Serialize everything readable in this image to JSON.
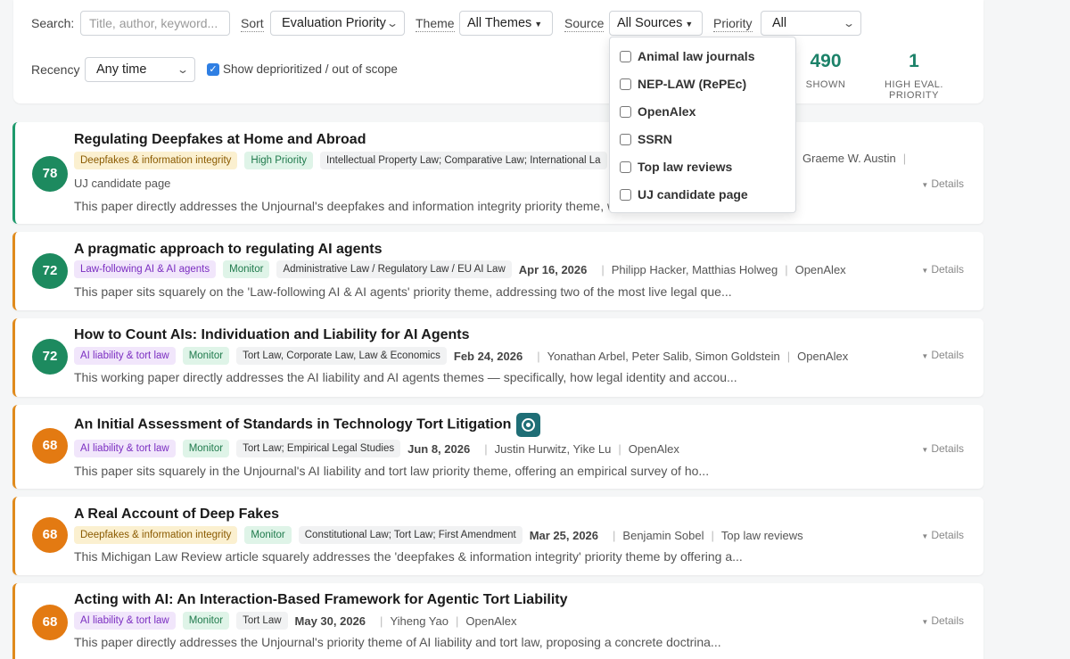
{
  "filters": {
    "search_label": "Search:",
    "search_placeholder": "Title, author, keyword...",
    "sort_label": "Sort",
    "sort_value": "Evaluation Priority",
    "theme_label": "Theme",
    "theme_value": "All Themes",
    "source_label": "Source",
    "source_value": "All Sources",
    "priority_label": "Priority",
    "priority_value": "All",
    "recency_label": "Recency",
    "recency_value": "Any time",
    "deprioritized_label": "Show deprioritized / out of scope",
    "deprioritized_checked": true
  },
  "stats": {
    "shown_value": "490",
    "shown_label": "SHOWN",
    "high_value": "1",
    "high_label": "HIGH EVAL. PRIORITY"
  },
  "source_dropdown": {
    "options": [
      "Animal law journals",
      "NEP-LAW (RePEc)",
      "OpenAlex",
      "SSRN",
      "Top law reviews",
      "UJ candidate page"
    ]
  },
  "details_label": "Details",
  "papers": [
    {
      "score": "78",
      "title": "Regulating Deepfakes at Home and Abroad",
      "theme": "Deepfakes & information integrity",
      "priority": "High Priority",
      "fields": "Intellectual Property Law; Comparative Law; International La",
      "authors": "Graeme W. Austin",
      "source": "UJ candidate page",
      "summary": "This paper directly addresses the Unjournal's deepfakes and information integrity priority theme, w"
    },
    {
      "score": "72",
      "title": "A pragmatic approach to regulating AI agents",
      "theme": "Law-following AI & AI agents",
      "priority": "Monitor",
      "fields": "Administrative Law / Regulatory Law / EU AI Law",
      "date": "Apr 16, 2026",
      "authors": "Philipp Hacker, Matthias Holweg",
      "source": "OpenAlex",
      "summary": "This paper sits squarely on the 'Law-following AI & AI agents' priority theme, addressing two of the most live legal que..."
    },
    {
      "score": "72",
      "title": "How to Count AIs: Individuation and Liability for AI Agents",
      "theme": "AI liability & tort law",
      "priority": "Monitor",
      "fields": "Tort Law, Corporate Law, Law & Economics",
      "date": "Feb 24, 2026",
      "authors": "Yonathan Arbel, Peter Salib, Simon Goldstein",
      "source": "OpenAlex",
      "summary": "This working paper directly addresses the AI liability and AI agents themes — specifically, how legal identity and accou..."
    },
    {
      "score": "68",
      "title": "An Initial Assessment of Standards in Technology Tort Litigation",
      "theme": "AI liability & tort law",
      "priority": "Monitor",
      "fields": "Tort Law; Empirical Legal Studies",
      "date": "Jun 8, 2026",
      "authors": "Justin Hurwitz, Yike Lu",
      "source": "OpenAlex",
      "summary": "This paper sits squarely in the Unjournal's AI liability and tort law priority theme, offering an empirical survey of ho..."
    },
    {
      "score": "68",
      "title": "A Real Account of Deep Fakes",
      "theme": "Deepfakes & information integrity",
      "priority": "Monitor",
      "fields": "Constitutional Law; Tort Law; First Amendment",
      "date": "Mar 25, 2026",
      "authors": "Benjamin Sobel",
      "source": "Top law reviews",
      "summary": "This Michigan Law Review article squarely addresses the 'deepfakes & information integrity' priority theme by offering a..."
    },
    {
      "score": "68",
      "title": "Acting with AI: An Interaction-Based Framework for Agentic Tort Liability",
      "theme": "AI liability & tort law",
      "priority": "Monitor",
      "fields": "Tort Law",
      "date": "May 30, 2026",
      "authors": "Yiheng Yao",
      "source": "OpenAlex",
      "summary": "This paper directly addresses the Unjournal's priority theme of AI liability and tort law, proposing a concrete doctrina..."
    }
  ],
  "colors": {
    "score_green": "#1d8a5f",
    "score_orange": "#e37a12",
    "accent_teal": "#1c8269"
  }
}
